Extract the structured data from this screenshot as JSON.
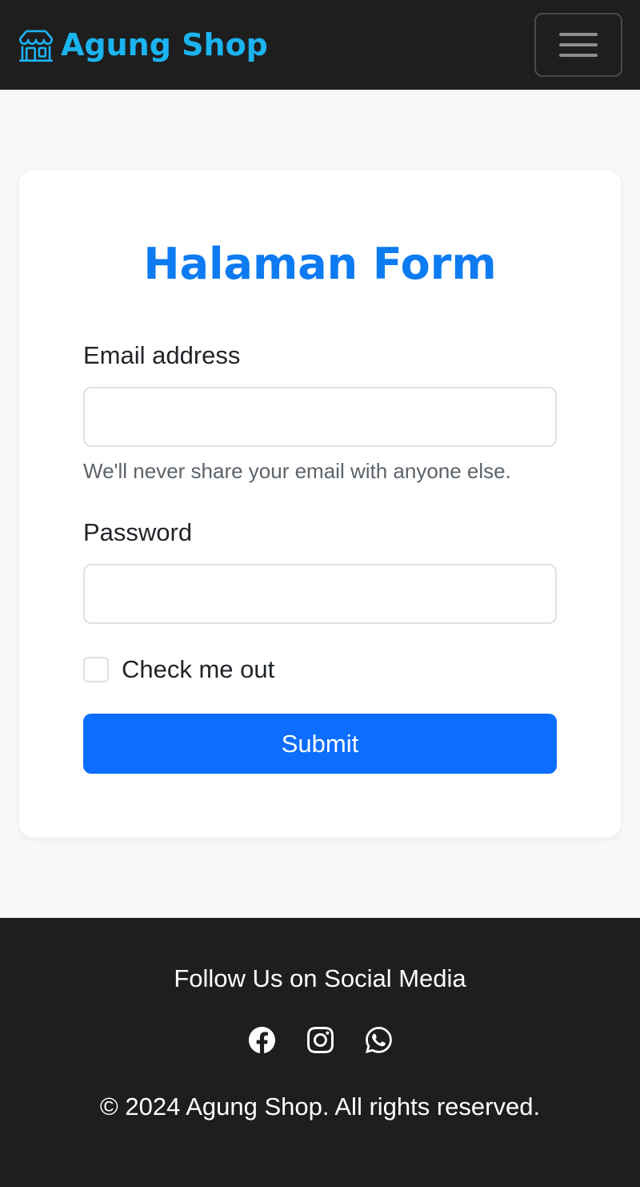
{
  "navbar": {
    "brand_icon": "shop-icon",
    "brand_text": "Agung Shop",
    "toggler_icon": "hamburger-menu-icon",
    "brand_color": "#1ab4f0",
    "background": "#1e1e1f"
  },
  "form": {
    "title": "Halaman Form",
    "title_color": "#0d7bf2",
    "email_label": "Email address",
    "email_value": "",
    "email_help": "We'll never share your email with anyone else.",
    "password_label": "Password",
    "password_value": "",
    "checkbox_label": "Check me out",
    "checkbox_checked": false,
    "submit_label": "Submit",
    "submit_color": "#0d6efd"
  },
  "footer": {
    "heading": "Follow Us on Social Media",
    "social_icons": [
      "facebook-icon",
      "instagram-icon",
      "whatsapp-icon"
    ],
    "copyright": "© 2024 Agung Shop. All rights reserved."
  }
}
